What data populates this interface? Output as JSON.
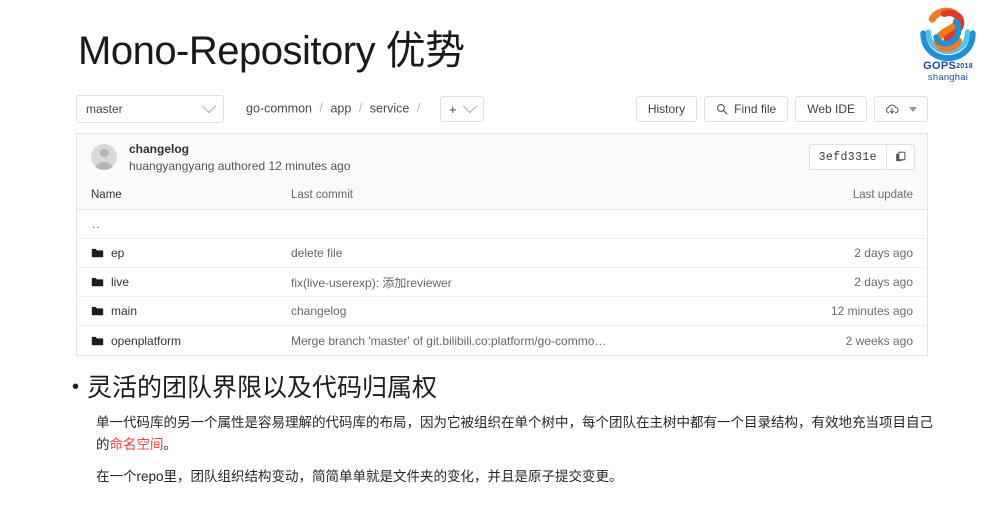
{
  "slide": {
    "title": "Mono-Repository 优势"
  },
  "logo": {
    "name": "GOPS",
    "year": "2018",
    "city": "shanghai",
    "colors": {
      "orange": "#f07c22",
      "red": "#e03a2f",
      "blue": "#1f8fd6",
      "deep_blue": "#1b4ea0",
      "cyan": "#57c1e9"
    }
  },
  "repo": {
    "branch_selector": {
      "value": "master",
      "icon": "chevron-down-icon"
    },
    "breadcrumb": {
      "items": [
        "go-common",
        "app",
        "service"
      ],
      "separator": "/"
    },
    "add_button": {
      "label": "+",
      "icon": "chevron-down-icon"
    },
    "actions": [
      {
        "label": "History",
        "icon": null
      },
      {
        "label": "Find file",
        "icon": "search-icon"
      },
      {
        "label": "Web IDE",
        "icon": null
      }
    ],
    "download_button": {
      "icon": "download-cloud-icon",
      "caret": "chevron-down-icon"
    },
    "commit": {
      "author_avatar": "user-avatar",
      "message": "changelog",
      "meta": "huangyangyang authored 12 minutes ago",
      "sha": "3efd331e",
      "copy_icon": "copy-icon"
    },
    "table": {
      "headers": {
        "name": "Name",
        "last_commit": "Last commit",
        "last_update": "Last update"
      },
      "parent_row": "..",
      "rows": [
        {
          "name": "ep",
          "icon": "folder-icon",
          "last_commit": "delete file",
          "last_update": "2 days ago"
        },
        {
          "name": "live",
          "icon": "folder-icon",
          "last_commit": "fix(live-userexp): 添加reviewer",
          "last_update": "2 days ago"
        },
        {
          "name": "main",
          "icon": "folder-icon",
          "last_commit": "changelog",
          "last_update": "12 minutes ago"
        },
        {
          "name": "openplatform",
          "icon": "folder-icon",
          "last_commit": "Merge branch 'master' of git.bilibili.co:platform/go-commo…",
          "last_update": "2 weeks ago"
        }
      ]
    }
  },
  "bullet": {
    "marker": "•",
    "heading": "灵活的团队界限以及代码归属权",
    "paragraph_1_a": "单一代码库的另一个属性是容易理解的代码库的布局，因为它被组织在单个树中，每个团队在主树中都有一个目录结构，有效地充当项目自己的",
    "paragraph_1_highlight": "命名空间",
    "paragraph_1_b": "。",
    "highlight_color": "#e8413a",
    "paragraph_2": "在一个repo里，团队组织结构变动，简简单单就是文件夹的变化，并且是原子提交变更。"
  }
}
